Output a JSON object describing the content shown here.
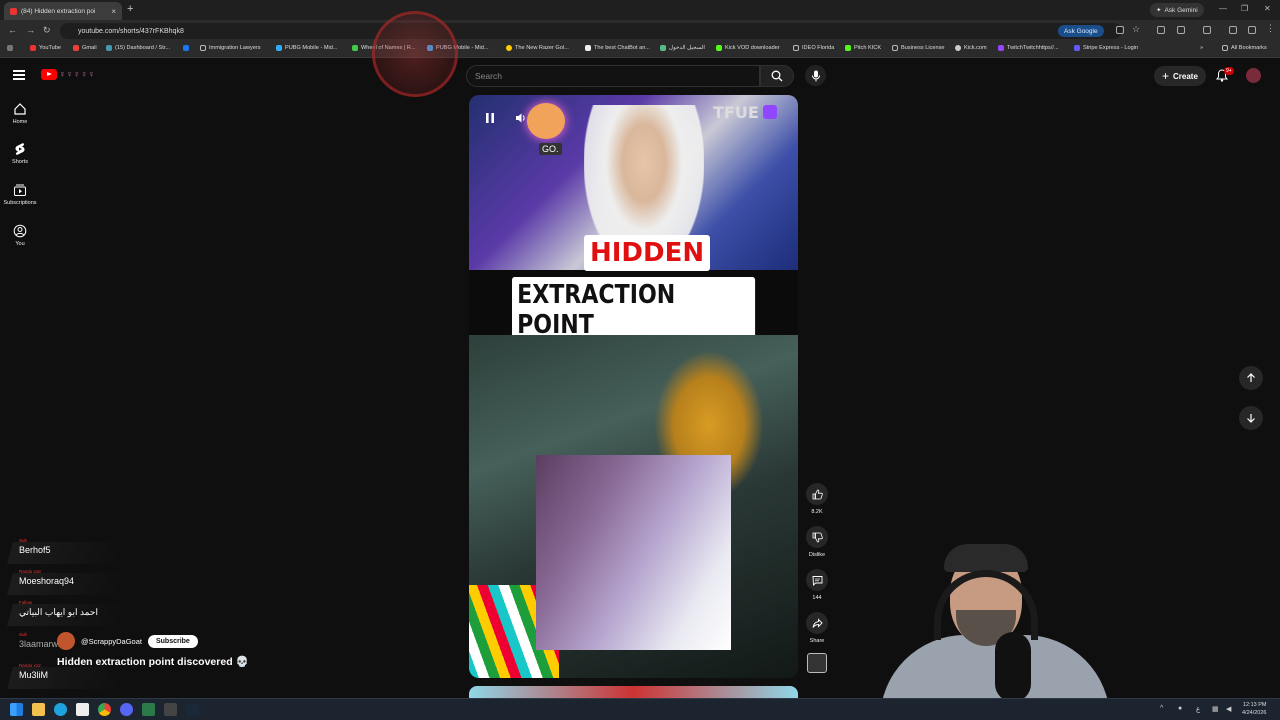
{
  "browser": {
    "tab_title": "(84) Hidden extraction poi",
    "new_tab": "+",
    "gemini": "Ask Gemini",
    "url": "youtube.com/shorts/437rFKBhqk8",
    "ask_google": "Ask Google",
    "bookmarks": [
      "YouTube",
      "Gmail",
      "(15) Dashboard / Str...",
      "",
      "Immigration Lawyers",
      "PUBG Mobile - Mid...",
      "Wheel of Names | R...",
      "PUBG Mobile - Mid...",
      "The New Razer Gol...",
      "The best ChatBot an...",
      "السجيل الدخول",
      "Kick VOD downloader",
      "IDEO Florida",
      "Pitch KICK",
      "Business License",
      "Kick.com",
      "TwitchTwitchhttps//...",
      "Stripe Express - Login"
    ],
    "all_bookmarks": "All Bookmarks"
  },
  "youtube": {
    "logo_text": "♀♀♀♀♀",
    "search_placeholder": "Search",
    "create_label": "Create",
    "notif_count": "9+",
    "sidebar": [
      {
        "label": "Home",
        "icon": "home-icon"
      },
      {
        "label": "Shorts",
        "icon": "shorts-icon"
      },
      {
        "label": "Subscriptions",
        "icon": "subscriptions-icon"
      },
      {
        "label": "You",
        "icon": "you-icon"
      }
    ]
  },
  "video": {
    "caption_line1": "HIDDEN",
    "caption_line2": "EXTRACTION POINT",
    "go_label": "GO.",
    "streamer_tag": "TFUE"
  },
  "actions": {
    "likes": "8.2K",
    "dislike_label": "Dislike",
    "comments": "144",
    "share_label": "Share"
  },
  "channel": {
    "handle": "@ScrappyDaGoat",
    "subscribe_label": "Subscribe",
    "title": "Hidden extraction point discovered 💀"
  },
  "chat": [
    {
      "tag": "Sub",
      "name": "Berhof5"
    },
    {
      "tag": "Rando x18",
      "name": "Moeshoraq94"
    },
    {
      "tag": "Follow",
      "name": "احمد ابو ايهاب البياتي"
    },
    {
      "tag": "Sub",
      "name": "3laamarwan"
    },
    {
      "tag": "Rando x12",
      "name": "Mu3liM"
    }
  ],
  "taskbar": {
    "time": "12:13 PM",
    "date": "4/24/2026"
  },
  "colors": {
    "youtube_red": "#ff0000",
    "caption_red": "#e01010",
    "subscribe_bg": "#ffffff",
    "ask_google_bg": "#1a4e8a"
  }
}
